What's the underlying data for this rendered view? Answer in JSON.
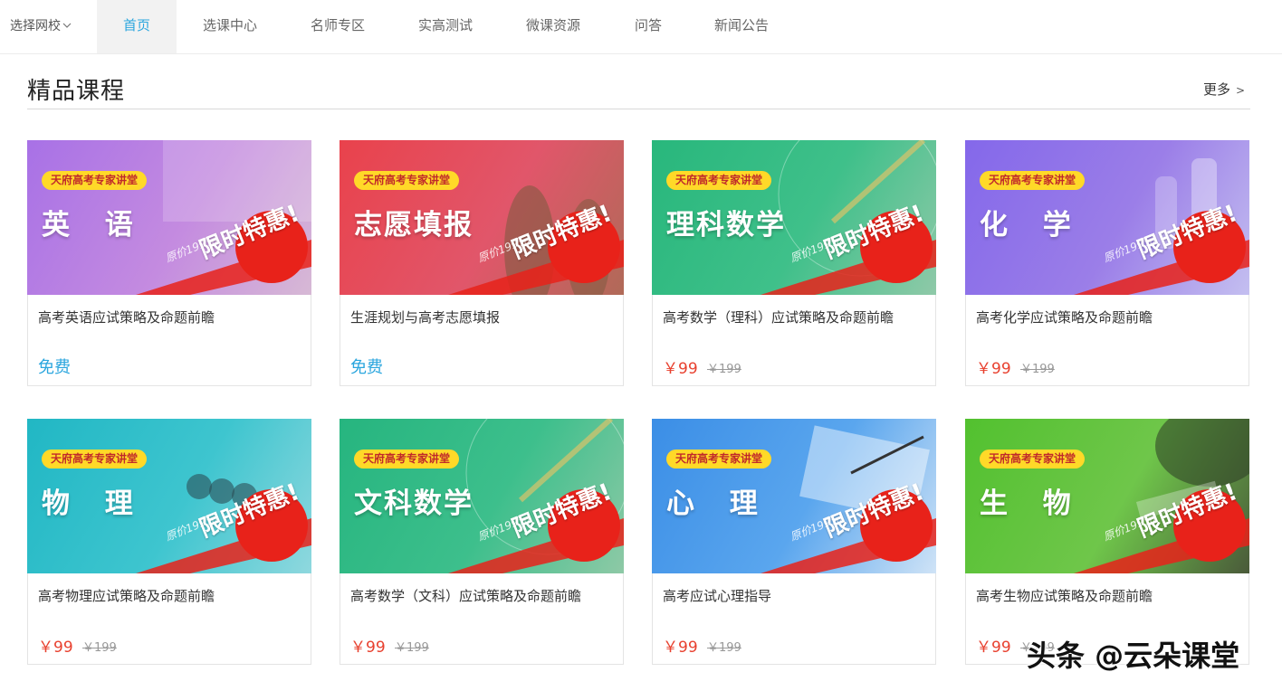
{
  "nav": {
    "school_select": "选择网校",
    "tabs": [
      "首页",
      "选课中心",
      "名师专区",
      "实高测试",
      "微课资源",
      "问答",
      "新闻公告"
    ]
  },
  "section": {
    "title": "精品课程",
    "more": "更多"
  },
  "banner_common": {
    "badge": "天府高考专家讲堂",
    "original_price": "原价199元",
    "promo": "限时特惠!"
  },
  "courses": [
    {
      "subject": "英 语",
      "title": "高考英语应试策略及命题前瞻",
      "price": "免费",
      "old_price": "",
      "free": true
    },
    {
      "subject": "志愿填报",
      "title": "生涯规划与高考志愿填报",
      "price": "免费",
      "old_price": "",
      "free": true
    },
    {
      "subject": "理科数学",
      "title": "高考数学（理科）应试策略及命题前瞻",
      "price": "￥99",
      "old_price": "￥199",
      "free": false
    },
    {
      "subject": "化 学",
      "title": "高考化学应试策略及命题前瞻",
      "price": "￥99",
      "old_price": "￥199",
      "free": false
    },
    {
      "subject": "物 理",
      "title": "高考物理应试策略及命题前瞻",
      "price": "￥99",
      "old_price": "￥199",
      "free": false
    },
    {
      "subject": "文科数学",
      "title": "高考数学（文科）应试策略及命题前瞻",
      "price": "￥99",
      "old_price": "￥199",
      "free": false
    },
    {
      "subject": "心 理",
      "title": "高考应试心理指导",
      "price": "￥99",
      "old_price": "￥199",
      "free": false
    },
    {
      "subject": "生 物",
      "title": "高考生物应试策略及命题前瞻",
      "price": "￥99",
      "old_price": "￥199",
      "free": false
    }
  ],
  "watermark": "头条 @云朵课堂",
  "colors": {
    "accent_blue": "#2ba6de",
    "price_red": "#e8412f",
    "badge_yellow": "#ffd928",
    "promo_red": "#e8221a"
  }
}
